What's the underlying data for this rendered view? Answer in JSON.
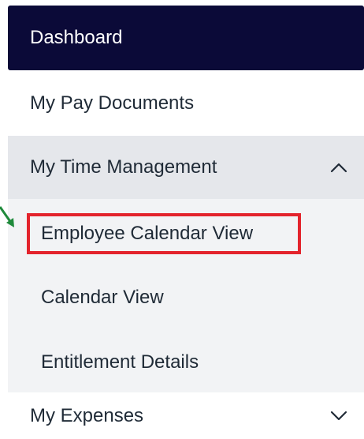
{
  "menu": {
    "dashboard_label": "Dashboard",
    "pay_documents_label": "My Pay Documents",
    "time_management": {
      "label": "My Time Management",
      "expanded": true,
      "chevron_icon": "chevron-up-icon",
      "children": {
        "employee_calendar_label": "Employee Calendar View",
        "calendar_view_label": "Calendar View",
        "entitlement_details_label": "Entitlement Details"
      }
    },
    "expenses": {
      "label": "My Expenses",
      "expanded": false,
      "chevron_icon": "chevron-down-icon"
    }
  },
  "colors": {
    "active_bg": "#0b0a38",
    "expanded_header_bg": "#e5e7eb",
    "submenu_bg": "#f2f3f5",
    "highlight_border": "#e3232c",
    "annotation_arrow": "#1f8a3b"
  }
}
